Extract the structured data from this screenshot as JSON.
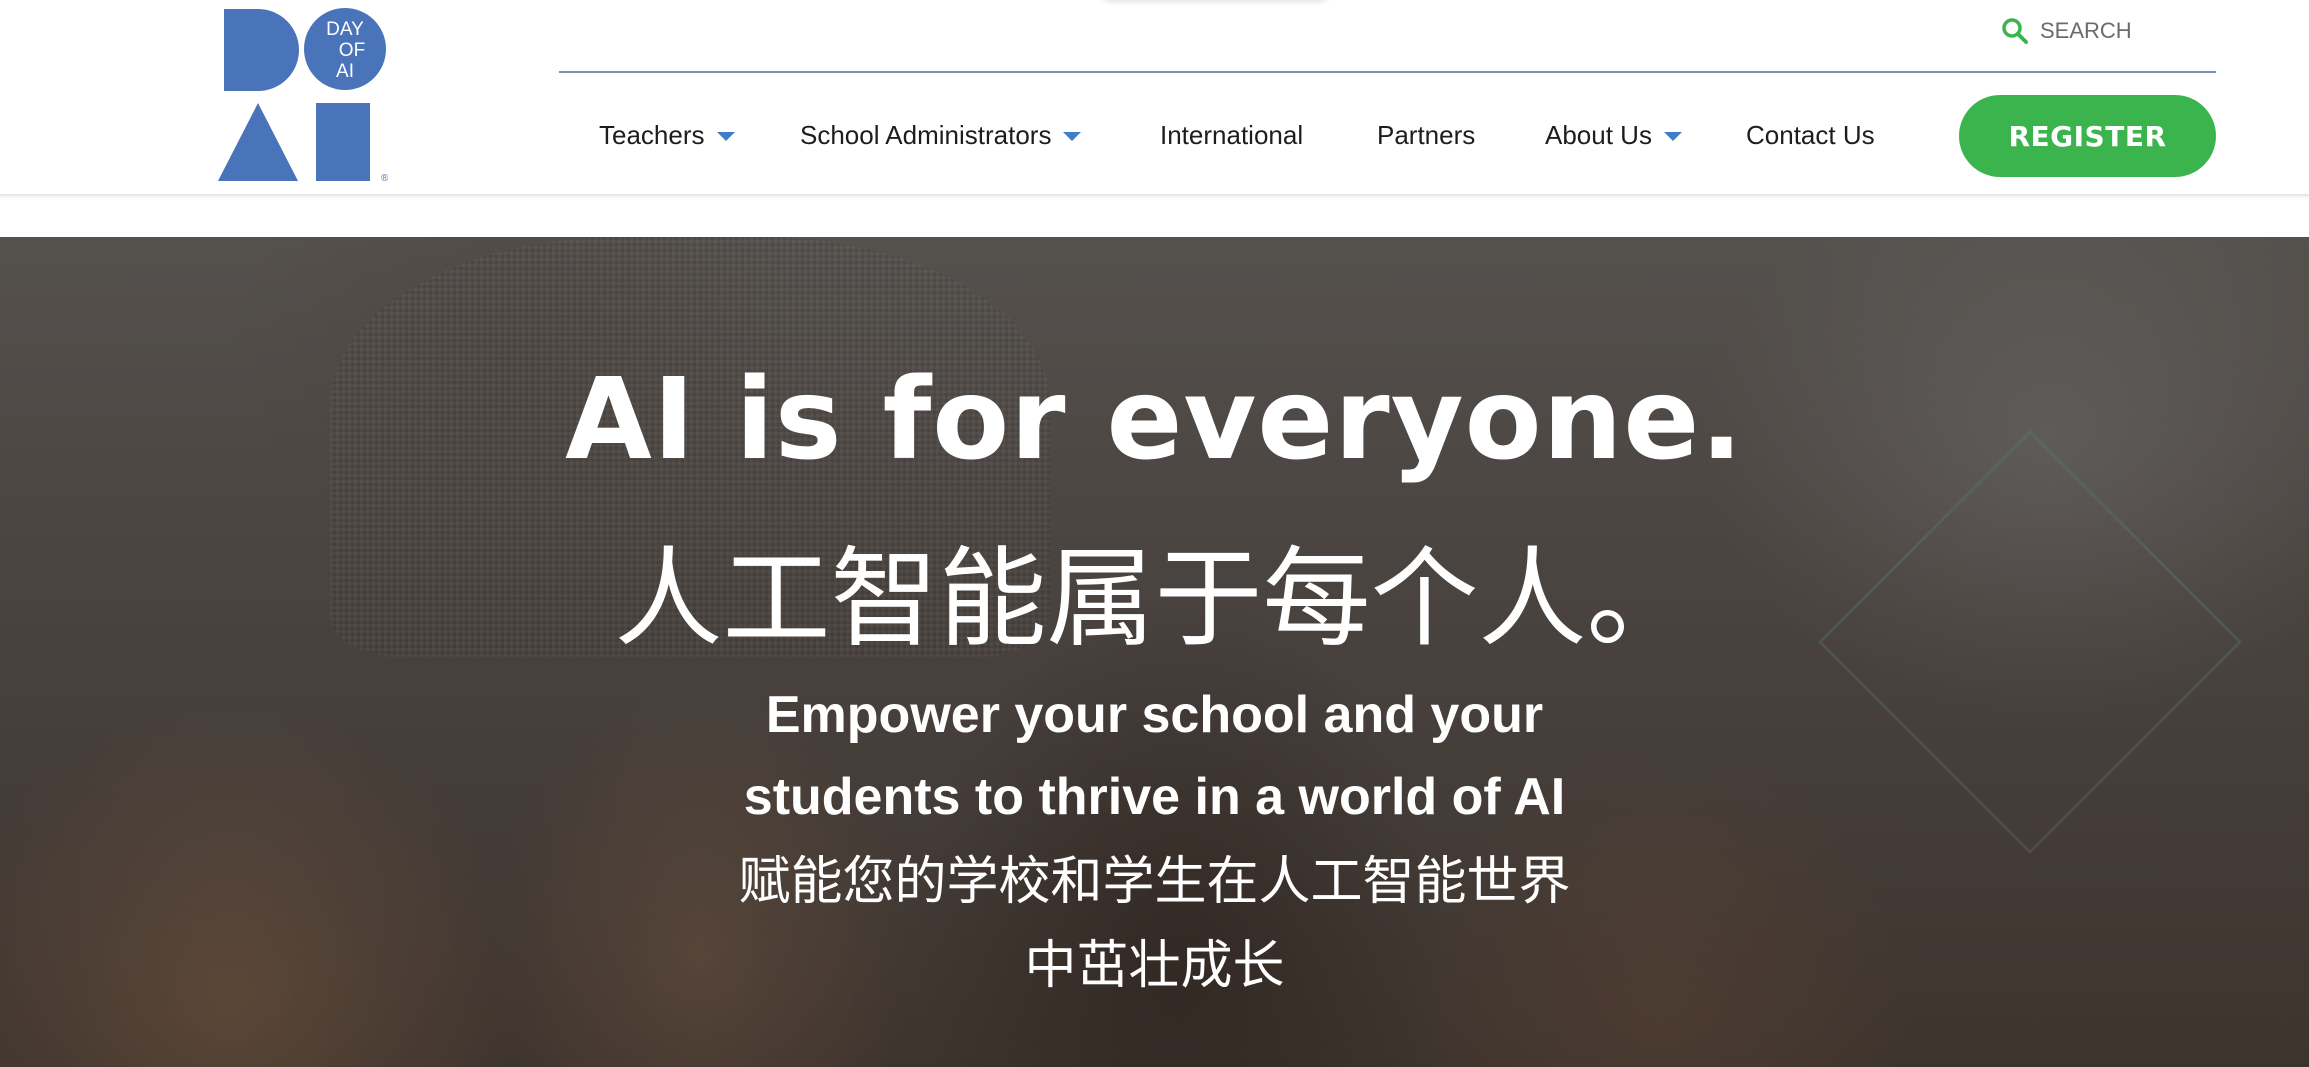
{
  "brand": {
    "logo_circle_text": [
      "DAY",
      "OF",
      "AI"
    ],
    "logo_mark": "®",
    "colors": {
      "logo_blue": "#4a74b9",
      "accent_green": "#3cb44d",
      "caret_blue": "#3f7dc8"
    }
  },
  "search": {
    "placeholder": "SEARCH",
    "icon": "search-icon"
  },
  "nav": {
    "items": [
      {
        "label": "Teachers",
        "has_dropdown": true
      },
      {
        "label": "School Administrators",
        "has_dropdown": true
      },
      {
        "label": "International",
        "has_dropdown": false
      },
      {
        "label": "Partners",
        "has_dropdown": false
      },
      {
        "label": "About Us",
        "has_dropdown": true
      },
      {
        "label": "Contact Us",
        "has_dropdown": false
      }
    ],
    "register_label": "REGISTER"
  },
  "hero": {
    "headline_en": "AI is for everyone.",
    "headline_zh": "人工智能属于每个人。",
    "subline_en_1": "Empower your school and your",
    "subline_en_2": "students to thrive in a world of AI",
    "subline_zh_1": "赋能您的学校和学生在人工智能世界",
    "subline_zh_2": "中茁壮成长"
  }
}
